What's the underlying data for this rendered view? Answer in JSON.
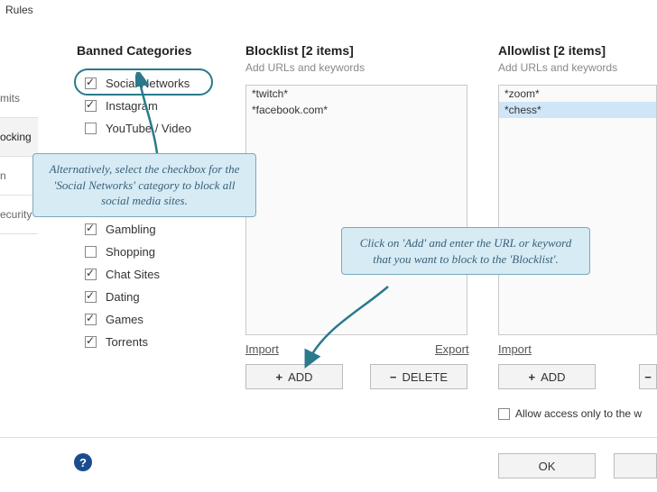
{
  "window": {
    "title": "Rules"
  },
  "sidebar": {
    "items": [
      {
        "label": "mits"
      },
      {
        "label": "ocking"
      },
      {
        "label": "n"
      },
      {
        "label": "ecurity"
      }
    ],
    "selected_index": 1
  },
  "banned": {
    "heading": "Banned Categories",
    "items": [
      {
        "label": "Social Networks",
        "checked": true
      },
      {
        "label": "Instagram",
        "checked": true
      },
      {
        "label": "YouTube / Video",
        "checked": false
      },
      {
        "label": "Gambling",
        "checked": true
      },
      {
        "label": "Shopping",
        "checked": false
      },
      {
        "label": "Chat Sites",
        "checked": true
      },
      {
        "label": "Dating",
        "checked": true
      },
      {
        "label": "Games",
        "checked": true
      },
      {
        "label": "Torrents",
        "checked": true
      }
    ],
    "gap_after_index": 2
  },
  "blocklist": {
    "heading": "Blocklist [2 items]",
    "subheading": "Add URLs and keywords",
    "items": [
      "*twitch*",
      "*facebook.com*"
    ],
    "import": "Import",
    "export": "Export",
    "add": "ADD",
    "delete": "DELETE"
  },
  "allowlist": {
    "heading": "Allowlist [2 items]",
    "subheading": "Add URLs and keywords",
    "items": [
      "*zoom*",
      "*chess*"
    ],
    "selected_index": 1,
    "import": "Import",
    "add": "ADD",
    "allow_only_label": "Allow access only to the w"
  },
  "footer": {
    "ok": "OK",
    "help": "?"
  },
  "callouts": {
    "left": "Alternatively, select the checkbox for the 'Social Networks' category to block all social media sites.",
    "right": "Click on 'Add' and enter the URL or keyword that you want to block to the 'Blocklist'."
  },
  "colors": {
    "accent": "#2a7a8c",
    "callout_bg": "#d7ebf5",
    "callout_border": "#7aa8bd"
  }
}
